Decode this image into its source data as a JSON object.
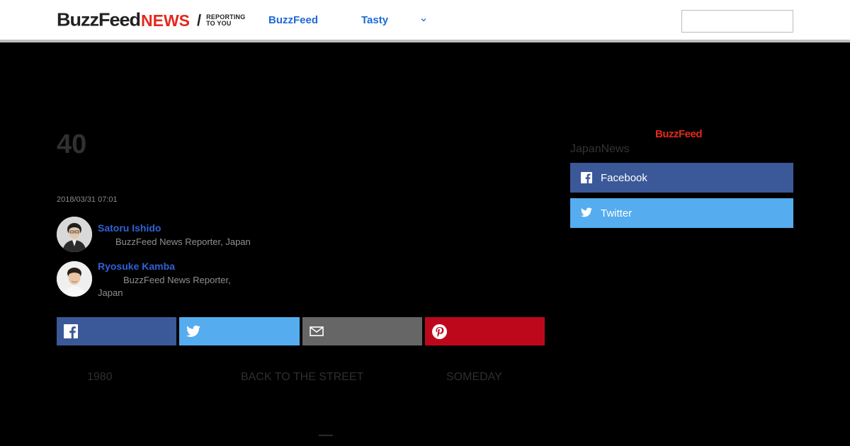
{
  "header": {
    "logo_buzz": "BuzzFeed",
    "logo_news": "NEWS",
    "logo_slash": "/",
    "logo_tagline": "REPORTING TO YOU",
    "nav": [
      {
        "label": "BuzzFeed"
      },
      {
        "label": "Tasty"
      }
    ],
    "more_icon": "chevron-down-icon",
    "search_value": ""
  },
  "article": {
    "headline": "40",
    "timestamp": "2018/03/31 07:01",
    "authors": [
      {
        "name": "Satoru Ishido",
        "role": "BuzzFeed News Reporter, Japan"
      },
      {
        "name": "Ryosuke Kamba",
        "role_line1": "BuzzFeed News Reporter,",
        "role_line2": "Japan"
      }
    ],
    "share_buttons": [
      {
        "icon": "facebook-icon",
        "color": "#3b5998"
      },
      {
        "icon": "twitter-icon",
        "color": "#55acee"
      },
      {
        "icon": "mail-icon",
        "color": "#666666"
      },
      {
        "icon": "pinterest-icon",
        "color": "#bd081c"
      }
    ],
    "related": [
      "1980",
      "BACK TO THE STREET",
      "SOMEDAY"
    ]
  },
  "sidebar": {
    "logo": "BuzzFeed",
    "title": "JapanNews",
    "follow": [
      {
        "label": "Facebook",
        "icon": "facebook-icon",
        "color": "#3b5998"
      },
      {
        "label": "Twitter",
        "icon": "twitter-icon",
        "color": "#55acee"
      }
    ]
  },
  "colors": {
    "brand_red": "#e32a1d",
    "link_blue": "#1e6ad6",
    "background": "#000000"
  }
}
